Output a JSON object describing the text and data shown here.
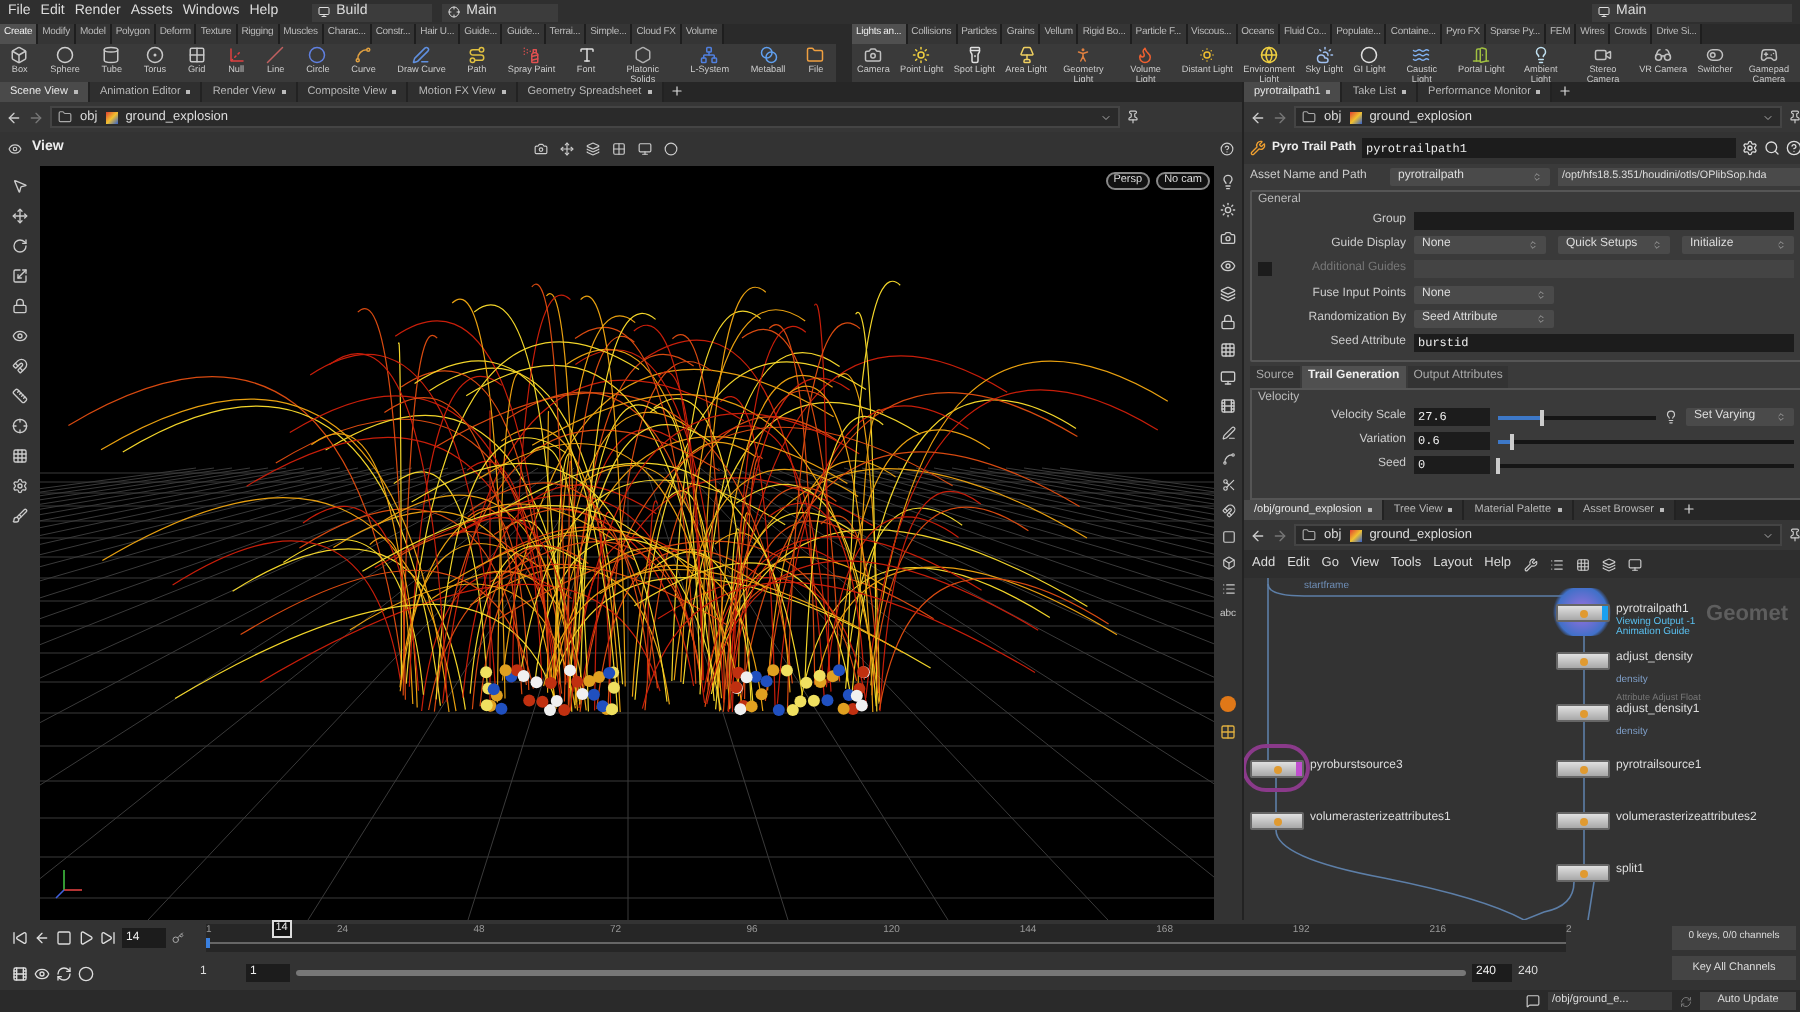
{
  "menu_bar": {
    "items": [
      "File",
      "Edit",
      "Render",
      "Assets",
      "Windows",
      "Help"
    ],
    "desktop": "Build",
    "workspace": "Main",
    "right_workspace": "Main"
  },
  "shelf_left": {
    "tabs": [
      {
        "label": "Create",
        "selected": true
      },
      {
        "label": "Modify",
        "selected": false
      },
      {
        "label": "Model",
        "selected": false
      },
      {
        "label": "Polygon",
        "selected": false
      },
      {
        "label": "Deform",
        "selected": false
      },
      {
        "label": "Texture",
        "selected": false
      },
      {
        "label": "Rigging",
        "selected": false
      },
      {
        "label": "Muscles",
        "selected": false
      },
      {
        "label": "Charac...",
        "selected": false
      },
      {
        "label": "Constr...",
        "selected": false
      },
      {
        "label": "Hair U...",
        "selected": false
      },
      {
        "label": "Guide...",
        "selected": false
      },
      {
        "label": "Guide...",
        "selected": false
      },
      {
        "label": "Terrai...",
        "selected": false
      },
      {
        "label": "Simple...",
        "selected": false
      },
      {
        "label": "Cloud FX",
        "selected": false
      },
      {
        "label": "Volume",
        "selected": false
      }
    ],
    "tools": [
      "Box",
      "Sphere",
      "Tube",
      "Torus",
      "Grid",
      "Null",
      "Line",
      "Circle",
      "Curve",
      "Draw Curve",
      "Path",
      "Spray Paint",
      "Font",
      "Platonic Solids",
      "L-System",
      "Metaball",
      "File"
    ]
  },
  "shelf_right": {
    "tabs": [
      {
        "label": "Lights an...",
        "selected": true
      },
      {
        "label": "Collisions",
        "selected": false
      },
      {
        "label": "Particles",
        "selected": false
      },
      {
        "label": "Grains",
        "selected": false
      },
      {
        "label": "Vellum",
        "selected": false
      },
      {
        "label": "Rigid Bo...",
        "selected": false
      },
      {
        "label": "Particle F...",
        "selected": false
      },
      {
        "label": "Viscous...",
        "selected": false
      },
      {
        "label": "Oceans",
        "selected": false
      },
      {
        "label": "Fluid Co...",
        "selected": false
      },
      {
        "label": "Populate...",
        "selected": false
      },
      {
        "label": "Containe...",
        "selected": false
      },
      {
        "label": "Pyro FX",
        "selected": false
      },
      {
        "label": "Sparse Py...",
        "selected": false
      },
      {
        "label": "FEM",
        "selected": false
      },
      {
        "label": "Wires",
        "selected": false
      },
      {
        "label": "Crowds",
        "selected": false
      },
      {
        "label": "Drive Si...",
        "selected": false
      }
    ],
    "tools": [
      "Camera",
      "Point Light",
      "Spot Light",
      "Area Light",
      "Geometry Light",
      "Volume Light",
      "Distant Light",
      "Environment Light",
      "Sky Light",
      "GI Light",
      "Caustic Light",
      "Portal Light",
      "Ambient Light",
      "Stereo Camera",
      "VR Camera",
      "Switcher",
      "Gamepad Camera"
    ]
  },
  "scene_pane": {
    "tabs": [
      {
        "label": "Scene View",
        "selected": true
      },
      {
        "label": "Animation Editor",
        "selected": false
      },
      {
        "label": "Render View",
        "selected": false
      },
      {
        "label": "Composite View",
        "selected": false
      },
      {
        "label": "Motion FX View",
        "selected": false
      },
      {
        "label": "Geometry Spreadsheet",
        "selected": false
      }
    ],
    "path": [
      "obj",
      "ground_explosion"
    ],
    "viewport": {
      "title": "View",
      "buttons": [
        "Persp",
        "No cam"
      ],
      "side_label": "abc"
    }
  },
  "params_pane": {
    "tabs": [
      {
        "label": "pyrotrailpath1",
        "selected": true
      },
      {
        "label": "Take List",
        "selected": false
      },
      {
        "label": "Performance Monitor",
        "selected": false
      }
    ],
    "path": [
      "obj",
      "ground_explosion"
    ],
    "node_type": "Pyro Trail Path",
    "node_name": "pyrotrailpath1",
    "asset": {
      "label": "Asset Name and Path",
      "name": "pyrotrailpath",
      "path": "/opt/hfs18.5.351/houdini/otls/OPlibSop.hda"
    },
    "section": "General",
    "fields": [
      {
        "kind": "text",
        "label": "Group",
        "disabled": false
      },
      {
        "kind": "menus",
        "label": "Guide Display",
        "value": "None",
        "menus": [
          "Quick Setups",
          "Initialize"
        ],
        "disabled": false
      },
      {
        "kind": "toggle",
        "label": "Additional Guides",
        "checked": false,
        "disabled": true
      },
      {
        "kind": "menu",
        "label": "Fuse Input Points",
        "value": "None",
        "disabled": false
      },
      {
        "kind": "menu",
        "label": "Randomization By",
        "value": "Seed Attribute",
        "disabled": false
      },
      {
        "kind": "text",
        "label": "Seed Attribute",
        "value": "burstid",
        "disabled": false
      }
    ],
    "subtabs": [
      {
        "label": "Source",
        "selected": false
      },
      {
        "label": "Trail Generation",
        "selected": true
      },
      {
        "label": "Output Attributes",
        "selected": false
      }
    ],
    "subsection": "Velocity",
    "sliders": [
      {
        "label": "Velocity Scale",
        "value": "27.6",
        "level": 0.28,
        "menu": "Set Varying"
      },
      {
        "label": "Variation",
        "value": "0.6",
        "level": 0.05
      },
      {
        "label": "Seed",
        "value": "0",
        "level": 0
      }
    ]
  },
  "network_pane": {
    "tabs": [
      {
        "label": "/obj/ground_explosion",
        "selected": true
      },
      {
        "label": "Tree View",
        "selected": false
      },
      {
        "label": "Material Palette",
        "selected": false
      },
      {
        "label": "Asset Browser",
        "selected": false
      }
    ],
    "path": [
      "obj",
      "ground_explosion"
    ],
    "menu": [
      "Add",
      "Edit",
      "Go",
      "View",
      "Tools",
      "Layout",
      "Help"
    ],
    "context_label": "Geomet",
    "top_label": "startframe",
    "nodes": [
      {
        "name": "pyrotrailpath1",
        "display": true,
        "template": false,
        "notes": [
          "Viewing Output -1",
          "Animation Guide"
        ]
      },
      {
        "name": "adjust_density",
        "display": false,
        "template": false,
        "attribute": "density"
      },
      {
        "name": "adjust_density1",
        "display": false,
        "template": false,
        "type_label": "Attribute Adjust Float",
        "attribute": "density"
      },
      {
        "name": "pyroburstsource3",
        "display": false,
        "template": true
      },
      {
        "name": "pyrotrailsource1",
        "display": false,
        "template": false
      },
      {
        "name": "volumerasterizeattributes1",
        "display": false,
        "template": false
      },
      {
        "name": "volumerasterizeattributes2",
        "display": false,
        "template": false
      },
      {
        "name": "split1",
        "display": false,
        "template": false
      }
    ]
  },
  "timeline": {
    "frame": "14",
    "playhead": {
      "label": "14",
      "level": 0.054
    },
    "ticks": [
      "1",
      "24",
      "48",
      "72",
      "96",
      "120",
      "144",
      "168",
      "192",
      "216",
      "2"
    ],
    "range_start": [
      "1",
      "1"
    ],
    "range_end": [
      "240",
      "240"
    ],
    "range": {
      "level": 1
    },
    "keys": "0 keys, 0/0 channels",
    "key_all": "Key All Channels"
  },
  "status_bar": {
    "path": "/obj/ground_e...",
    "update": "Auto Update"
  }
}
